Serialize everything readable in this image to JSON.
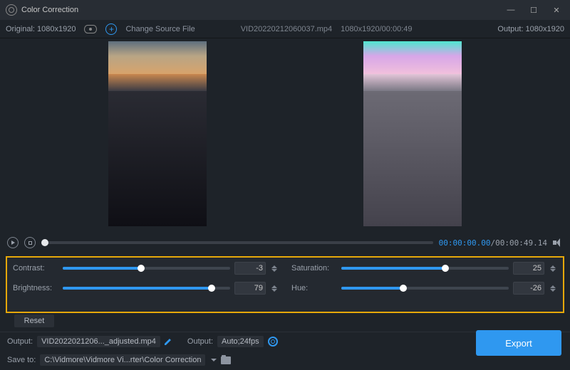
{
  "window": {
    "title": "Color Correction"
  },
  "header": {
    "original_label": "Original: 1080x1920",
    "change_source_label": "Change Source File",
    "file_name": "VID20220212060037.mp4",
    "file_meta": "1080x1920/00:00:49",
    "output_label": "Output: 1080x1920"
  },
  "transport": {
    "current_time": "00:00:00.00",
    "duration": "/00:00:49.14"
  },
  "sliders": {
    "contrast": {
      "label": "Contrast:",
      "value": "-3",
      "fillPct": "47",
      "thumbPct": "47"
    },
    "saturation": {
      "label": "Saturation:",
      "value": "25",
      "fillPct": "62",
      "thumbPct": "62"
    },
    "brightness": {
      "label": "Brightness:",
      "value": "79",
      "fillPct": "89",
      "thumbPct": "89"
    },
    "hue": {
      "label": "Hue:",
      "value": "-26",
      "fillPct": "37",
      "thumbPct": "37"
    }
  },
  "buttons": {
    "reset": "Reset",
    "export": "Export"
  },
  "output": {
    "label": "Output:",
    "filename": "VID2022021206..._adjusted.mp4",
    "settings_label": "Output:",
    "settings_value": "Auto;24fps"
  },
  "saveto": {
    "label": "Save to:",
    "path": "C:\\Vidmore\\Vidmore Vi...rter\\Color Correction"
  }
}
